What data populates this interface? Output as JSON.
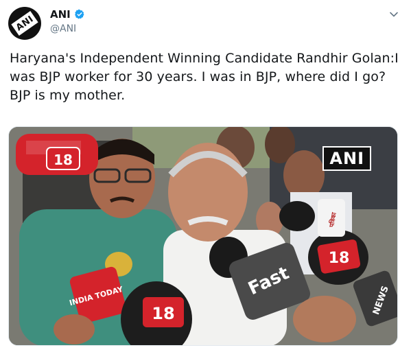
{
  "account": {
    "display_name": "ANI",
    "handle": "@ANI",
    "avatar_logo": "ANI",
    "verified_icon": "verified-badge-icon"
  },
  "tweet": {
    "text": "Haryana's Independent Winning Candidate Randhir Golan:I was BJP worker for 30 years. I was in BJP, where did I go? BJP is my mother."
  },
  "media": {
    "watermark": "ANI",
    "mic_labels": {
      "news18_a": "18",
      "news18_b": "18",
      "news18_c": "18",
      "india_today": "INDIA TODAY",
      "fast": "Fast",
      "news": "NEWS",
      "hindi": "पत्रिका"
    }
  },
  "colors": {
    "brand_blue": "#1da1f2",
    "text": "#14171a",
    "secondary": "#657786",
    "border": "#e1e8ed"
  }
}
